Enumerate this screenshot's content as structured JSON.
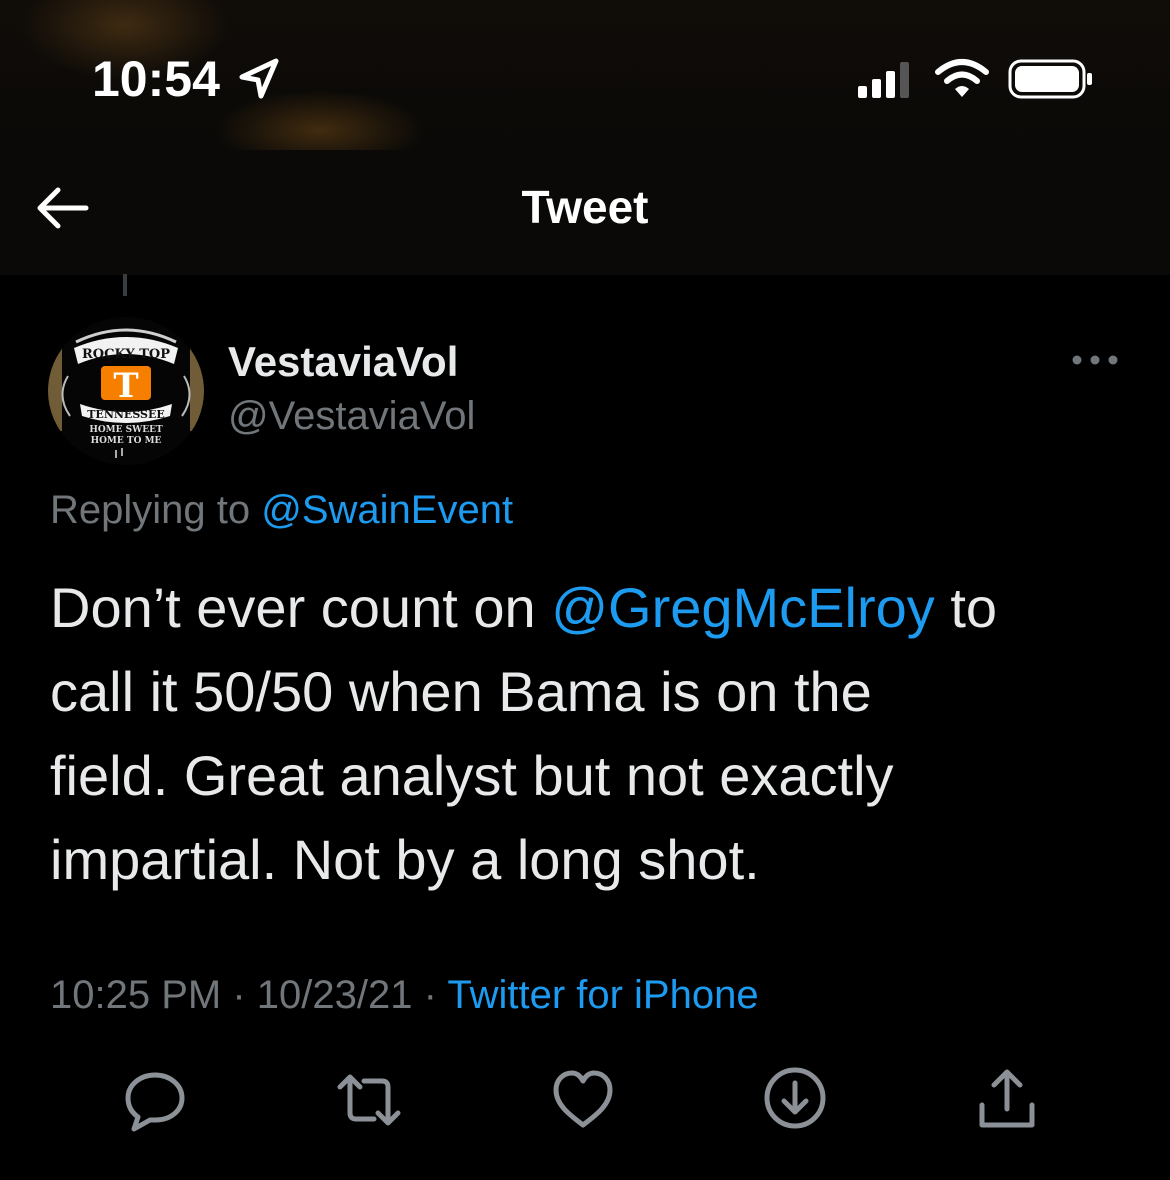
{
  "status_bar": {
    "time": "10:54",
    "icons": [
      "location-arrow-icon",
      "cellular-signal-icon",
      "wifi-icon",
      "battery-icon"
    ]
  },
  "nav": {
    "title": "Tweet",
    "back_icon": "arrow-left-icon"
  },
  "tweet": {
    "author": {
      "display_name": "VestaviaVol",
      "handle": "@VestaviaVol",
      "avatar_text": [
        "ROCKY TOP",
        "T",
        "TENNESSEE",
        "HOME SWEET",
        "HOME TO ME"
      ]
    },
    "replying_to_prefix": "Replying to",
    "replying_to_handle": "@SwainEvent",
    "text_lines": [
      {
        "before": "Don’t ever count on ",
        "mention": "@GregMcElroy",
        "after": " to"
      },
      {
        "text": "call it 50/50 when Bama is on the"
      },
      {
        "text": "field. Great analyst but not exactly"
      },
      {
        "text": "impartial. Not by a long shot."
      }
    ],
    "time": "10:25 PM",
    "separator": "·",
    "date": "10/23/21",
    "source": "Twitter for iPhone"
  },
  "actions": [
    "reply-icon",
    "retweet-icon",
    "like-icon",
    "download-icon",
    "share-icon"
  ],
  "colors": {
    "background": "#000000",
    "text": "#e7e9ea",
    "secondary": "#71767b",
    "accent": "#1d9bf0",
    "avatar_orange": "#f77f00"
  }
}
